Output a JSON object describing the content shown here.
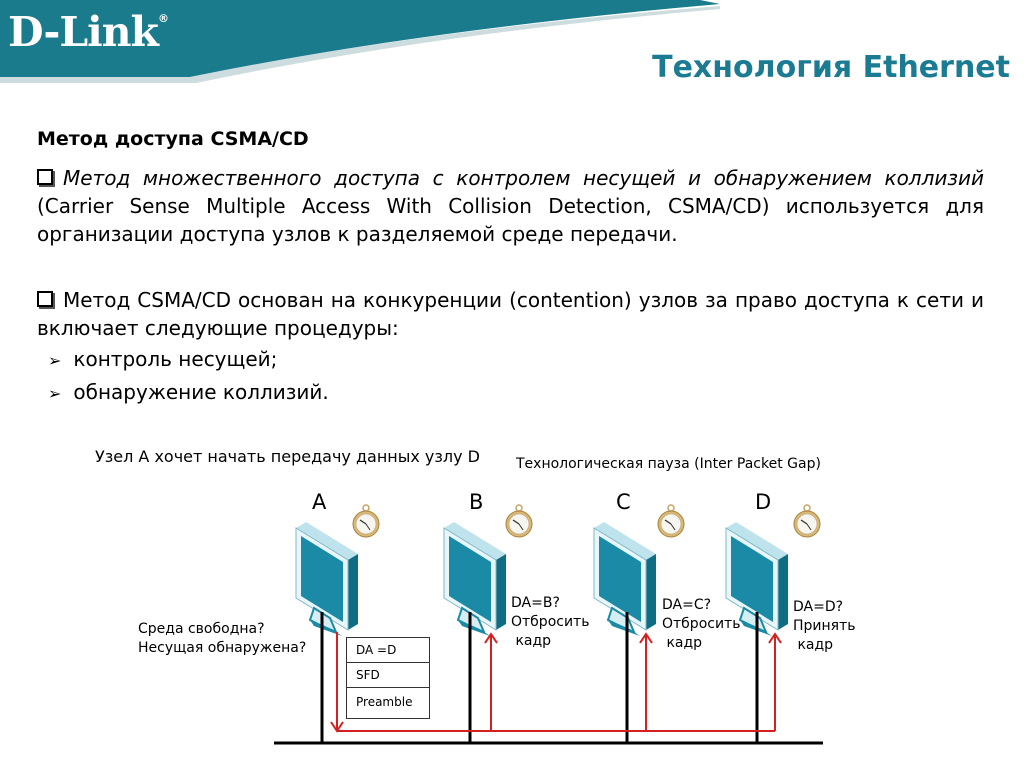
{
  "header": {
    "logo_text": "D-Link",
    "logo_mark": "®",
    "title": "Технология Ethernet",
    "brand_color": "#1a7b93"
  },
  "content": {
    "subtitle": "Метод доступа CSMA/CD",
    "paragraph1_italic": "Метод множественного доступа с контролем несущей и обнаружением коллизий",
    "paragraph1_rest": " (Carrier Sense Multiple Access With Collision Detection, CSMA/CD) используется для организации доступа узлов к разделяемой среде передачи.",
    "paragraph2": "Метод CSMA/CD основан на конкуренции (contention) узлов за право доступа к сети и включает следующие процедуры:",
    "bullets": [
      "контроль несущей;",
      "обнаружение коллизий."
    ]
  },
  "diagram": {
    "caption_main": "Узел А хочет начать передачу данных узлу D",
    "caption_gap": "Технологическая пауза (Inter Packet Gap)",
    "nodes": [
      {
        "label": "A"
      },
      {
        "label": "B",
        "note": [
          "DA=B?",
          "Отбросить",
          " кадр"
        ]
      },
      {
        "label": "C",
        "note": [
          "DA=C?",
          "Отбросить",
          " кадр"
        ]
      },
      {
        "label": "D",
        "note": [
          "DA=D?",
          "Принять",
          " кадр"
        ]
      }
    ],
    "sender_note": [
      "Среда свободна?",
      "Несущая обнаружена?"
    ],
    "frame_fields": [
      "DA =D",
      "SFD",
      "Preamble"
    ],
    "signal_color": "#d42020",
    "monitor_color": "#1a8aa6"
  }
}
